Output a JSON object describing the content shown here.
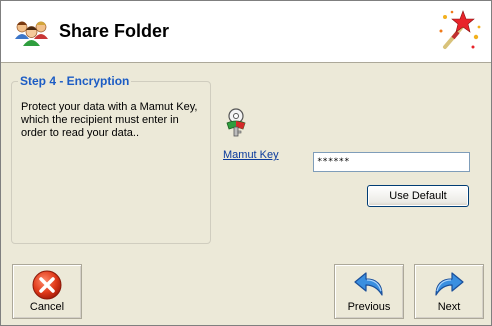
{
  "header": {
    "title": "Share Folder",
    "icon": "users-group-icon",
    "wizard_icon": "magic-wand-icon"
  },
  "step": {
    "title": "Step 4 - Encryption",
    "description": "Protect your data with a Mamut Key, which the recipient must enter in order to read your data.."
  },
  "key": {
    "icon": "key-icon",
    "link_label": "Mamut Key",
    "input_value": "******",
    "use_default_label": "Use Default"
  },
  "buttons": {
    "cancel": "Cancel",
    "previous": "Previous",
    "next": "Next"
  },
  "colors": {
    "step_title": "#1c5cc4",
    "link": "#0b3b9d",
    "background": "#ece9d8",
    "header_background": "#ffffff"
  }
}
